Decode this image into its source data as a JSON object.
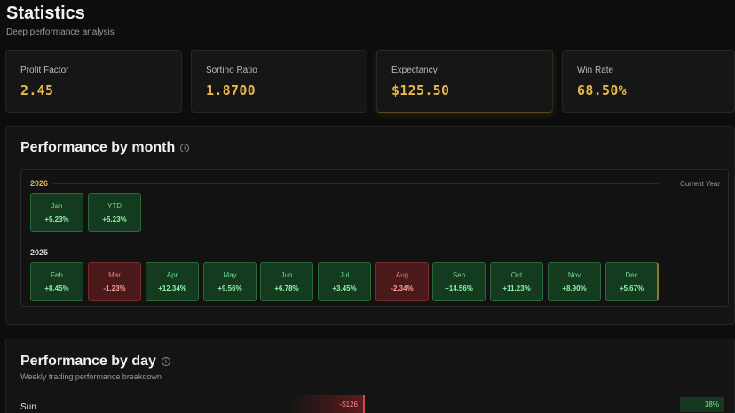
{
  "header": {
    "title": "Statistics",
    "subtitle": "Deep performance analysis"
  },
  "kpis": [
    {
      "label": "Profit Factor",
      "value": "2.45"
    },
    {
      "label": "Sortino Ratio",
      "value": "1.8700"
    },
    {
      "label": "Expectancy",
      "value": "$125.50"
    },
    {
      "label": "Win Rate",
      "value": "68.50%"
    }
  ],
  "month_panel": {
    "title": "Performance by month",
    "years": [
      {
        "year": "2026",
        "tag": "Current Year",
        "months": [
          {
            "name": "Jan",
            "value": "+5.23%",
            "status": "positive"
          },
          {
            "name": "YTD",
            "value": "+5.23%",
            "status": "positive"
          }
        ]
      },
      {
        "year": "2025",
        "months": [
          {
            "name": "Feb",
            "value": "+8.45%",
            "status": "positive"
          },
          {
            "name": "Mar",
            "value": "-1.23%",
            "status": "negative"
          },
          {
            "name": "Apr",
            "value": "+12.34%",
            "status": "positive"
          },
          {
            "name": "May",
            "value": "+9.56%",
            "status": "positive"
          },
          {
            "name": "Jun",
            "value": "+6.78%",
            "status": "positive"
          },
          {
            "name": "Jul",
            "value": "+3.45%",
            "status": "positive"
          },
          {
            "name": "Aug",
            "value": "-2.34%",
            "status": "negative"
          },
          {
            "name": "Sep",
            "value": "+14.56%",
            "status": "positive"
          },
          {
            "name": "Oct",
            "value": "+11.23%",
            "status": "positive"
          },
          {
            "name": "Nov",
            "value": "+8.90%",
            "status": "positive"
          },
          {
            "name": "Dec",
            "value": "+5.67%",
            "status": "positive"
          }
        ]
      }
    ]
  },
  "day_panel": {
    "title": "Performance by day",
    "subtitle": "Weekly trading performance breakdown",
    "days": [
      {
        "day": "Sun",
        "pnl": "-$126",
        "win_rate": "38%"
      }
    ]
  },
  "colors": {
    "accent": "#e8b94a",
    "positive": "#8ff2a6",
    "negative": "#ff9a9a",
    "background": "#0d0d0d"
  }
}
